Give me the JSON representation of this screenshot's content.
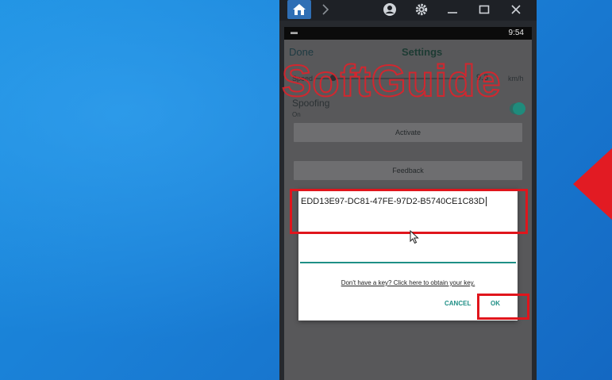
{
  "watermark": "SoftGuide",
  "status_bar": {
    "time": "9:54"
  },
  "settings": {
    "done_label": "Done",
    "title": "Settings",
    "speed_label": "Speed",
    "speed_value": "9.3",
    "speed_unit": "km/h",
    "spoofing_label": "Spoofing",
    "spoofing_state": "On",
    "activate_label": "Activate",
    "feedback_label": "Feedback"
  },
  "dialog": {
    "key_value": "EDD13E97-DC81-47FE-97D2-B5740CE1C83D",
    "obtain_link": "Don't have a key? Click here to obtain your key.",
    "cancel_label": "CANCEL",
    "ok_label": "OK"
  },
  "icons": [
    "home-icon",
    "chevron-right-icon",
    "account-icon",
    "gear-icon",
    "minimize-icon",
    "maximize-icon",
    "close-icon"
  ],
  "colors": {
    "accent": "#1f8f86",
    "highlight": "#e0151c",
    "desktop": "#1a7fd6"
  }
}
